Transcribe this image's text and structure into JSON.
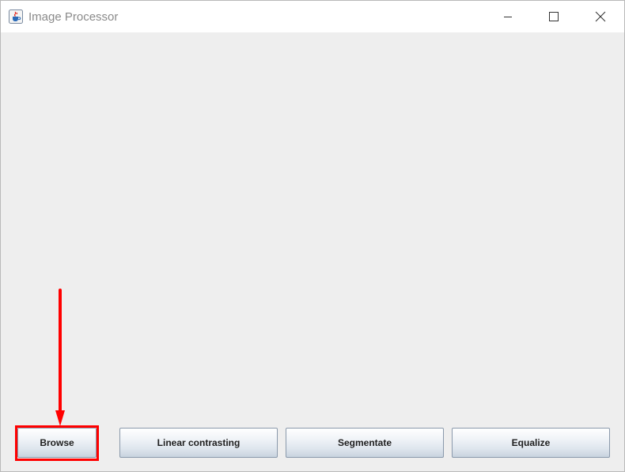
{
  "window": {
    "title": "Image Processor",
    "controls": {
      "minimize_icon": "minimize-icon",
      "maximize_icon": "maximize-icon",
      "close_icon": "close-icon"
    },
    "app_icon": "java-cup-icon"
  },
  "toolbar": {
    "buttons": [
      {
        "label": "Browse"
      },
      {
        "label": "Linear contrasting"
      },
      {
        "label": "Segmentate"
      },
      {
        "label": "Equalize"
      }
    ]
  },
  "annotation": {
    "highlight_color": "#ff0000",
    "target": "Browse"
  },
  "colors": {
    "content_bg": "#eeeeee",
    "titlebar_bg": "#ffffff",
    "title_text": "#8a8a8a"
  }
}
